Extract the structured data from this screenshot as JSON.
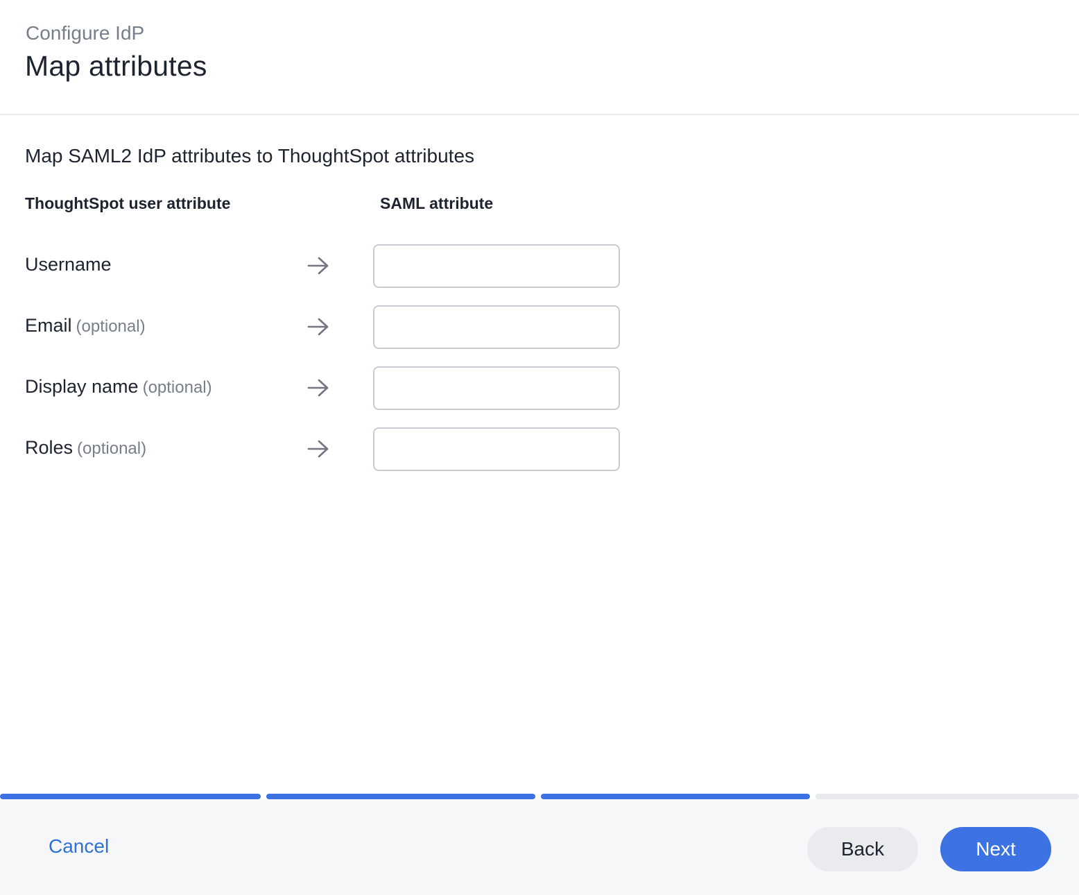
{
  "header": {
    "eyebrow": "Configure IdP",
    "title": "Map attributes"
  },
  "intro": "Map SAML2 IdP attributes to ThoughtSpot attributes",
  "columns": {
    "left": "ThoughtSpot user attribute",
    "right": "SAML attribute"
  },
  "rows": [
    {
      "label": "Username",
      "optional": "",
      "value": ""
    },
    {
      "label": "Email",
      "optional": "(optional)",
      "value": ""
    },
    {
      "label": "Display name",
      "optional": "(optional)",
      "value": ""
    },
    {
      "label": "Roles",
      "optional": "(optional)",
      "value": ""
    }
  ],
  "icons": {
    "row_arrow": "arrow-right-icon"
  },
  "progress": {
    "total_steps": 4,
    "completed_steps": 3,
    "active_color": "#3c72e2",
    "inactive_color": "#e8eaed"
  },
  "footer": {
    "cancel_label": "Cancel",
    "back_label": "Back",
    "next_label": "Next"
  }
}
